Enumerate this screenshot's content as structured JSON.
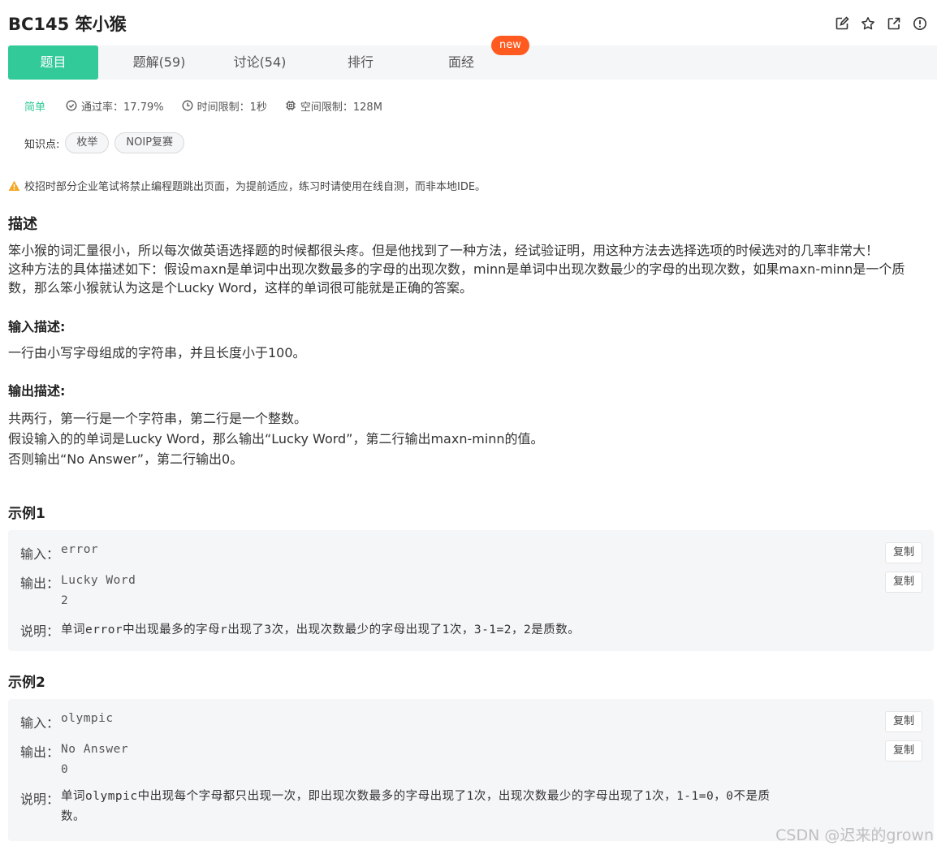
{
  "header": {
    "title": "BC145  笨小猴",
    "icons": [
      "edit-icon",
      "star-icon",
      "share-icon",
      "report-icon"
    ]
  },
  "tabs": [
    {
      "label": "题目",
      "active": true
    },
    {
      "label": "题解(59)",
      "active": false
    },
    {
      "label": "讨论(54)",
      "active": false
    },
    {
      "label": "排行",
      "active": false
    },
    {
      "label": "面经",
      "active": false
    }
  ],
  "new_badge": "new",
  "meta": {
    "difficulty": "简单",
    "pass_rate": "通过率：17.79%",
    "time_limit": "时间限制：1秒",
    "space_limit": "空间限制：128M"
  },
  "knowledge": {
    "label": "知识点:",
    "tags": [
      "枚举",
      "NOIP复赛"
    ]
  },
  "warning": "校招时部分企业笔试将禁止编程题跳出页面，为提前适应，练习时请使用在线自测，而非本地IDE。",
  "description": {
    "heading": "描述",
    "lines": [
      "笨小猴的词汇量很小，所以每次做英语选择题的时候都很头疼。但是他找到了一种方法，经试验证明，用这种方法去选择选项的时候选对的几率非常大！",
      "这种方法的具体描述如下：假设maxn是单词中出现次数最多的字母的出现次数，minn是单词中出现次数最少的字母的出现次数，如果maxn-minn是一个质",
      "数，那么笨小猴就认为这是个Lucky Word，这样的单词很可能就是正确的答案。"
    ]
  },
  "input_desc": {
    "heading": "输入描述:",
    "lines": [
      "一行由小写字母组成的字符串，并且长度小于100。"
    ]
  },
  "output_desc": {
    "heading": "输出描述:",
    "lines": [
      "共两行，第一行是一个字符串，第二行是一个整数。",
      "假设输入的的单词是Lucky Word，那么输出“Lucky Word”，第二行输出maxn-minn的值。",
      "否则输出“No Answer”，第二行输出0。"
    ]
  },
  "examples": [
    {
      "heading": "示例1",
      "input_label": "输入：",
      "input": "error",
      "output_label": "输出：",
      "output_line1": "Lucky Word",
      "output_line2": "2",
      "explain_label": "说明：",
      "explain_line1": "单词error中出现最多的字母r出现了3次，出现次数最少的字母出现了1次，3-1=2，2是质数。",
      "explain_line2": "",
      "copy": "复制"
    },
    {
      "heading": "示例2",
      "input_label": "输入：",
      "input": "olympic",
      "output_label": "输出：",
      "output_line1": "No Answer",
      "output_line2": "0",
      "explain_label": "说明：",
      "explain_line1": "单词olympic中出现每个字母都只出现一次，即出现次数最多的字母出现了1次，出现次数最少的字母出现了1次，1-1=0，0不是质",
      "explain_line2": "数。",
      "copy": "复制"
    }
  ],
  "watermark": "CSDN @迟来的grown",
  "colors": {
    "accent": "#32ca99",
    "badge": "#ff5a1f",
    "panel": "#f5f6f8",
    "warning": "#f5a623"
  }
}
